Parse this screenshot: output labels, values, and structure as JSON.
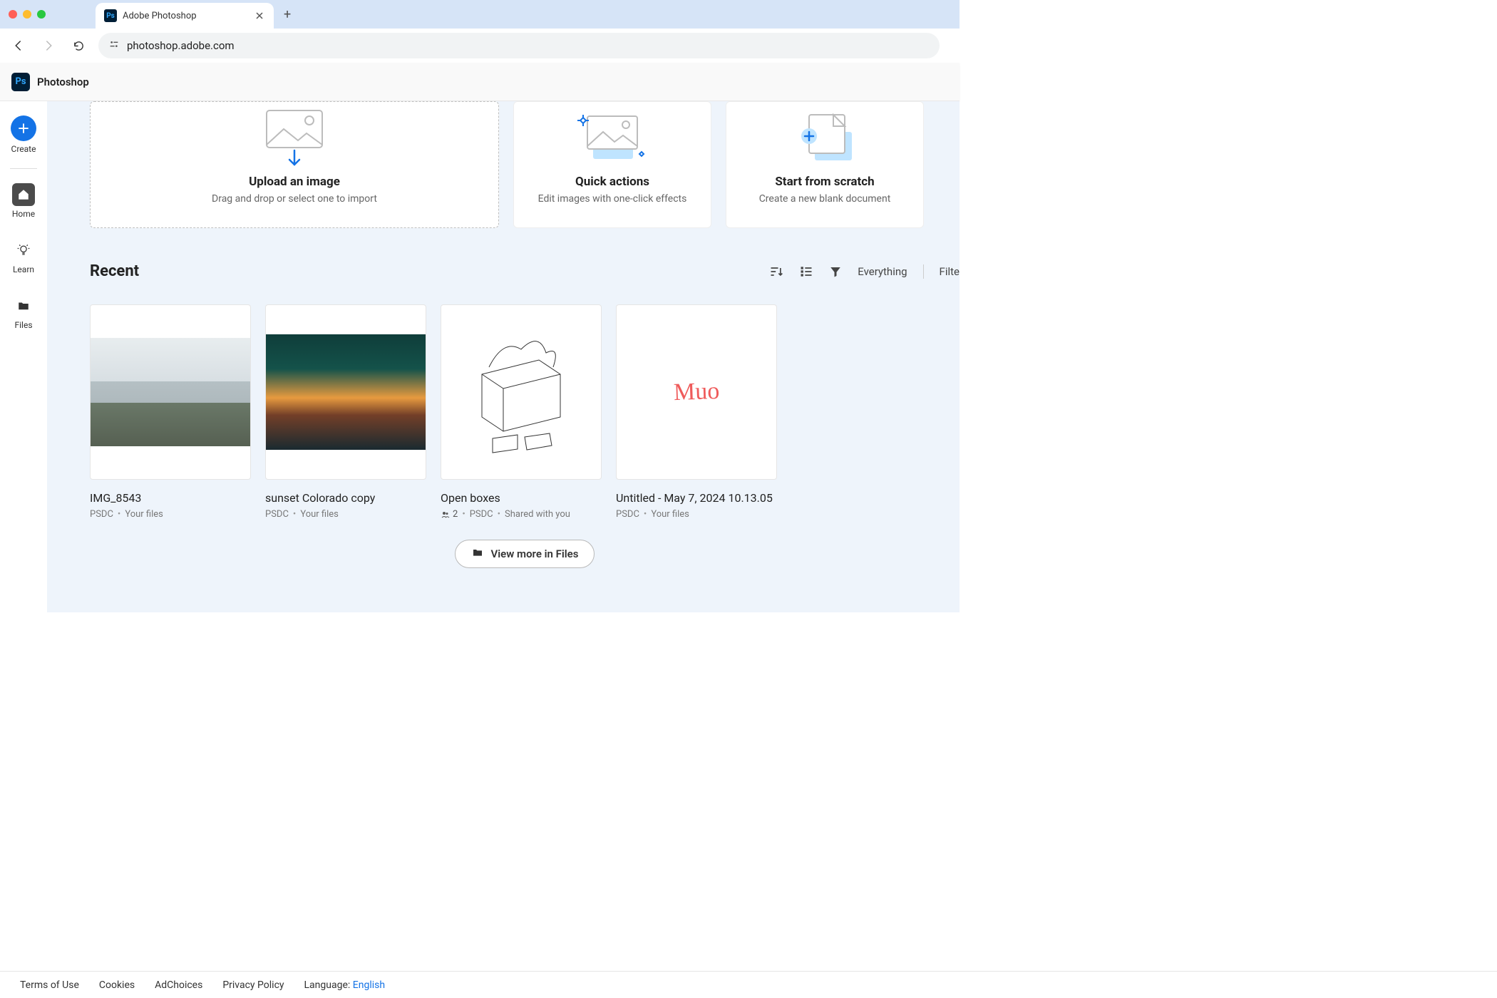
{
  "browser": {
    "tab_title": "Adobe Photoshop",
    "url": "photoshop.adobe.com"
  },
  "app": {
    "title": "Photoshop"
  },
  "sidebar": {
    "create": "Create",
    "home": "Home",
    "learn": "Learn",
    "files": "Files"
  },
  "cards": {
    "upload": {
      "title": "Upload an image",
      "sub": "Drag and drop or select one to import"
    },
    "quick": {
      "title": "Quick actions",
      "sub": "Edit images with one-click effects"
    },
    "scratch": {
      "title": "Start from scratch",
      "sub": "Create a new blank document"
    }
  },
  "recent": {
    "title": "Recent",
    "filter_label": "Everything",
    "filter_extra": "Filte",
    "files": [
      {
        "name": "IMG_8543",
        "type": "PSDC",
        "location": "Your files"
      },
      {
        "name": "sunset Colorado copy",
        "type": "PSDC",
        "location": "Your files"
      },
      {
        "name": "Open boxes",
        "type": "PSDC",
        "location": "Shared with you",
        "shared_count": "2"
      },
      {
        "name": "Untitled - May 7, 2024 10.13.05",
        "type": "PSDC",
        "location": "Your files"
      }
    ],
    "view_more": "View more in Files"
  },
  "footer": {
    "terms": "Terms of Use",
    "cookies": "Cookies",
    "adchoices": "AdChoices",
    "privacy": "Privacy Policy",
    "language_label": "Language:",
    "language_value": "English"
  }
}
